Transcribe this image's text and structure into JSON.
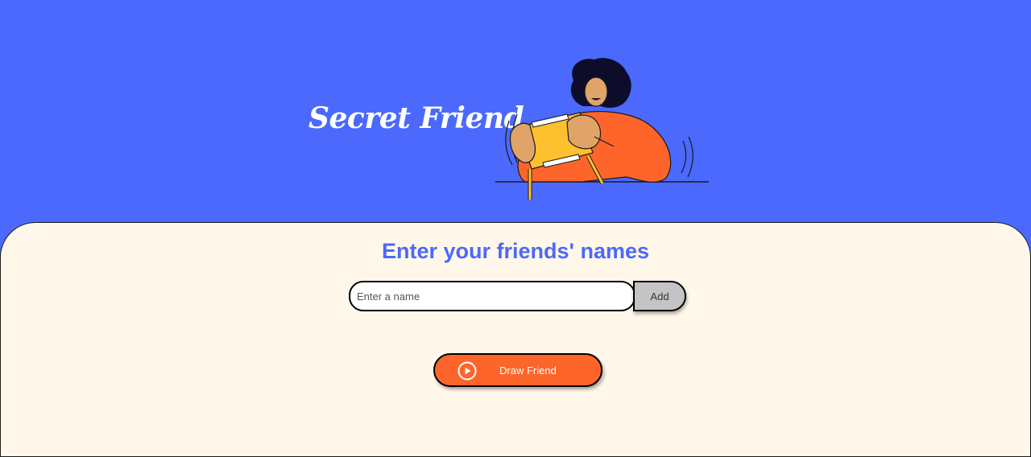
{
  "header": {
    "title": "Secret Friend",
    "illustration_icon": "person-holding-gift-illustration"
  },
  "main": {
    "subtitle": "Enter your friends' names",
    "name_input": {
      "value": "",
      "placeholder": "Enter a name"
    },
    "add_label": "Add",
    "draw_label": "Draw Friend",
    "draw_icon": "play-circle-icon"
  },
  "colors": {
    "background": "#4B69FD",
    "panel": "#FFF8EA",
    "accent": "#FE652B",
    "add_button": "#C4C4C4"
  }
}
